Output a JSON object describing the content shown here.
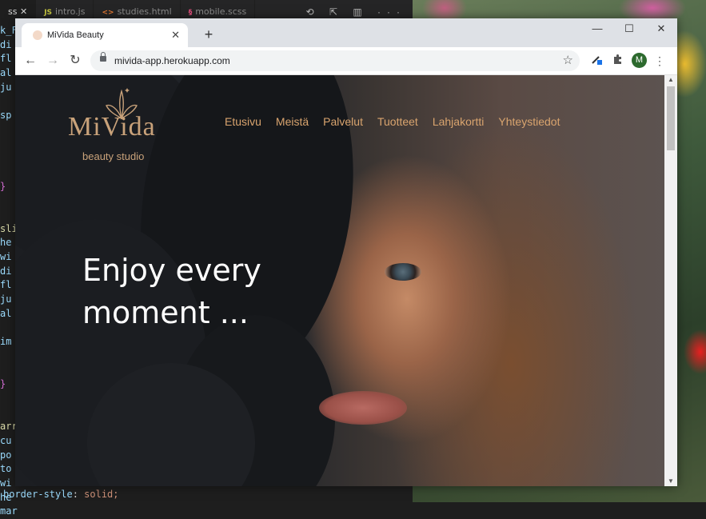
{
  "editor": {
    "tabs": [
      {
        "lang": "",
        "label": "ss"
      },
      {
        "lang": "JS",
        "label": "intro.js"
      },
      {
        "lang": "<>",
        "label": "studies.html"
      },
      {
        "lang": "§",
        "label": "mobile.scss"
      }
    ],
    "actions": "⟲ ⇱ ▥ ···",
    "lines": [
      "k_F",
      "di",
      "fl",
      "al",
      "ju",
      "",
      "sp",
      "",
      "",
      "",
      "",
      "}",
      "",
      "",
      "sli",
      "he",
      "wi",
      "di",
      "fl",
      "ju",
      "al",
      "",
      "im",
      "",
      "",
      "}",
      "",
      "",
      "arr",
      "cu",
      "po",
      "to",
      "wi",
      "he",
      "mar"
    ],
    "bottom_prop": "border-style",
    "bottom_value": "solid;"
  },
  "browser": {
    "tab_title": "MiVida Beauty",
    "tab_close": "✕",
    "new_tab": "+",
    "window_min": "—",
    "window_max": "☐",
    "window_close": "✕",
    "back": "←",
    "forward": "→",
    "reload": "↻",
    "url": "mivida-app.herokuapp.com",
    "star": "☆",
    "avatar_letter": "M",
    "menu": "⋮"
  },
  "site": {
    "logo_word": "MiVida",
    "logo_sub": "beauty studio",
    "nav": [
      "Etusivu",
      "Meistä",
      "Palvelut",
      "Tuotteet",
      "Lahjakortti",
      "Yhteystiedot"
    ],
    "hero_line1": "Enjoy every",
    "hero_line2": "moment ..."
  },
  "colors": {
    "accent_gold": "#d9a46e",
    "logo_gold": "#c9a27a"
  }
}
